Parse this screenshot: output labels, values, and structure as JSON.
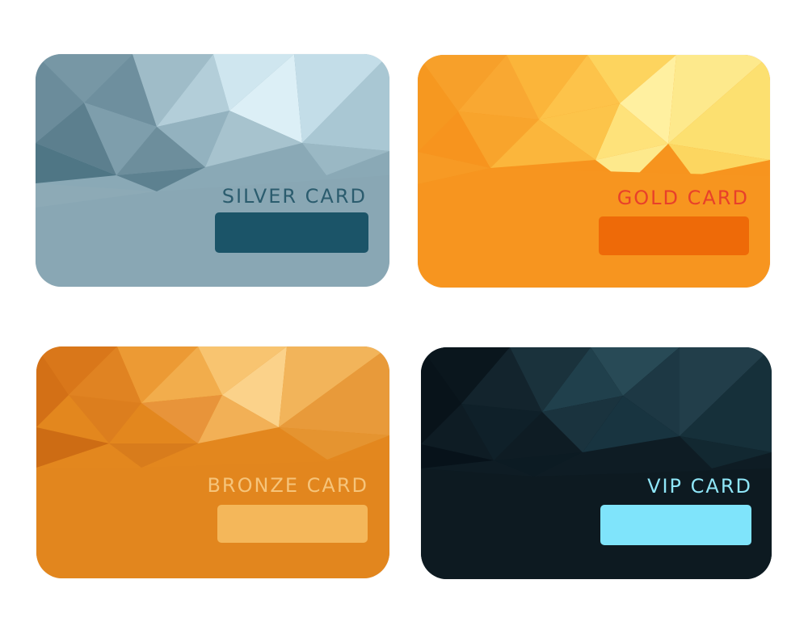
{
  "cards": [
    {
      "id": "silver",
      "title": "SILVER CARD",
      "title_color": "#2b5c6e",
      "slot_color": "#1b5468",
      "base_color": "#86a6b3",
      "light_color": "#d8eef5",
      "dark_color": "#4f7887"
    },
    {
      "id": "gold",
      "title": "GOLD CARD",
      "title_color": "#e8402a",
      "slot_color": "#ee6a08",
      "base_color": "#f7951f",
      "light_color": "#fff6b0",
      "dark_color": "#f4861a"
    },
    {
      "id": "bronze",
      "title": "BRONZE CARD",
      "title_color": "#f6c47a",
      "slot_color": "#f4b75a",
      "base_color": "#e2861d",
      "light_color": "#fbd08e",
      "dark_color": "#c86a14"
    },
    {
      "id": "vip",
      "title": "VIP CARD",
      "title_color": "#8fe6f8",
      "slot_color": "#7fe4fb",
      "base_color": "#0f1e26",
      "light_color": "#2c4d59",
      "dark_color": "#071218"
    }
  ],
  "watermark": "#81472242"
}
